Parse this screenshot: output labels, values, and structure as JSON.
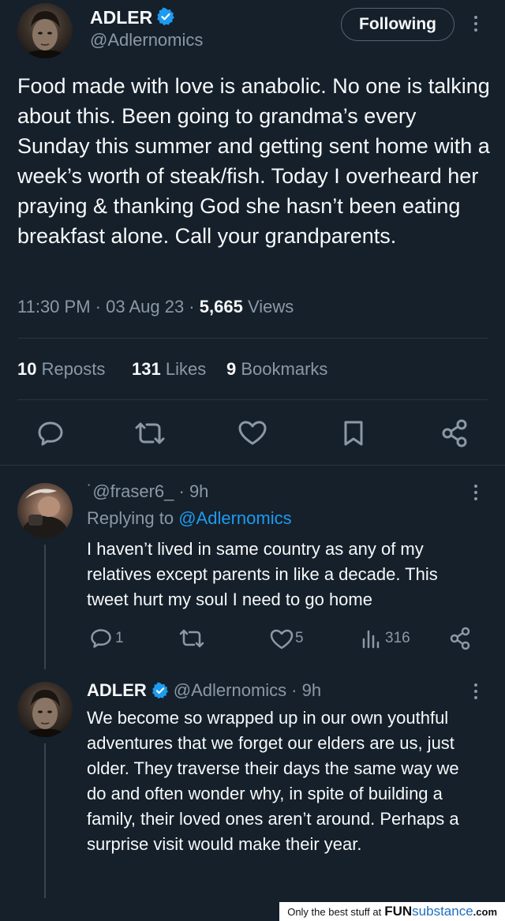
{
  "main_tweet": {
    "display_name": "ADLER",
    "handle": "@Adlernomics",
    "follow_label": "Following",
    "text": "Food made with love is anabolic. No one is talking about this. Been going to grandma’s every Sunday this summer and getting sent home with a week’s worth of steak/fish. Today I overheard her praying & thanking God she hasn’t been eating breakfast alone. Call your grandparents.",
    "timestamp": "11:30 PM · 03 Aug 23 ·",
    "views_count": "5,665",
    "views_label": "Views",
    "stats": {
      "reposts_count": "10",
      "reposts_label": "Reposts",
      "likes_count": "131",
      "likes_label": "Likes",
      "bookmarks_count": "9",
      "bookmarks_label": "Bookmarks"
    }
  },
  "reply_1": {
    "handle": "˙@fraser6_",
    "time": "· 9h",
    "replying_prefix": "Replying to",
    "replying_handle": "@Adlernomics",
    "text": "I haven’t lived in same country as any of my relatives except parents in like a decade. This tweet hurt my soul I need to go home",
    "actions": {
      "replies": "1",
      "reposts": "",
      "likes": "5",
      "views": "316"
    }
  },
  "reply_2": {
    "display_name": "ADLER",
    "handle": "@Adlernomics",
    "time": "· 9h",
    "text": "We become so wrapped up in our own youthful adventures that we forget our elders are us, just older. They traverse their days the same way we do and often wonder why, in spite of building a family, their loved ones aren’t around. Perhaps a surprise visit would make their year."
  },
  "footer": {
    "tagline": "Only the best stuff at",
    "brand_bold": "FUN",
    "brand_rest": "substance",
    "brand_suffix": ".com"
  },
  "colors": {
    "background": "#15202b",
    "text": "#f7f9f9",
    "muted": "#8b98a5",
    "link": "#1d9bf0",
    "verified": "#1d9bf0"
  },
  "icons": [
    "verified-badge-icon",
    "more-options-icon",
    "reply-icon",
    "repost-icon",
    "like-icon",
    "bookmark-icon",
    "share-icon",
    "views-icon"
  ]
}
